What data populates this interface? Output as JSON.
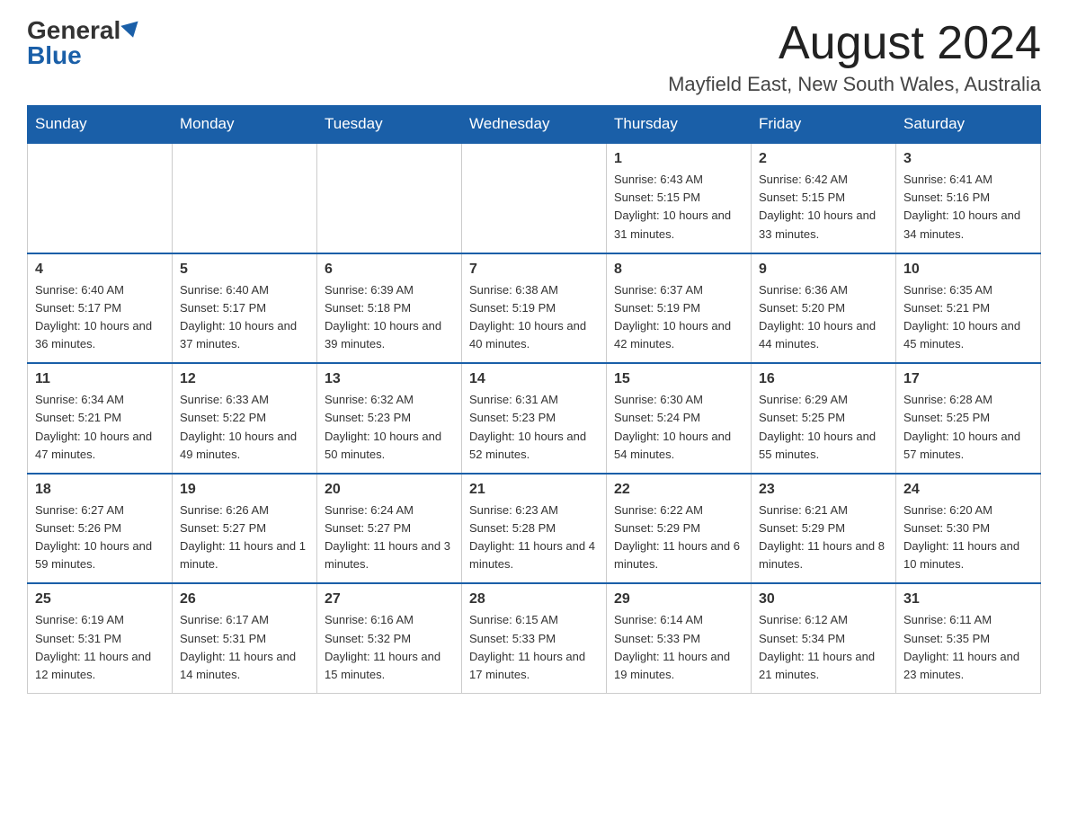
{
  "logo": {
    "general": "General",
    "blue": "Blue"
  },
  "title": {
    "month_year": "August 2024",
    "location": "Mayfield East, New South Wales, Australia"
  },
  "days_of_week": [
    "Sunday",
    "Monday",
    "Tuesday",
    "Wednesday",
    "Thursday",
    "Friday",
    "Saturday"
  ],
  "weeks": [
    [
      {
        "day": "",
        "info": ""
      },
      {
        "day": "",
        "info": ""
      },
      {
        "day": "",
        "info": ""
      },
      {
        "day": "",
        "info": ""
      },
      {
        "day": "1",
        "info": "Sunrise: 6:43 AM\nSunset: 5:15 PM\nDaylight: 10 hours and 31 minutes."
      },
      {
        "day": "2",
        "info": "Sunrise: 6:42 AM\nSunset: 5:15 PM\nDaylight: 10 hours and 33 minutes."
      },
      {
        "day": "3",
        "info": "Sunrise: 6:41 AM\nSunset: 5:16 PM\nDaylight: 10 hours and 34 minutes."
      }
    ],
    [
      {
        "day": "4",
        "info": "Sunrise: 6:40 AM\nSunset: 5:17 PM\nDaylight: 10 hours and 36 minutes."
      },
      {
        "day": "5",
        "info": "Sunrise: 6:40 AM\nSunset: 5:17 PM\nDaylight: 10 hours and 37 minutes."
      },
      {
        "day": "6",
        "info": "Sunrise: 6:39 AM\nSunset: 5:18 PM\nDaylight: 10 hours and 39 minutes."
      },
      {
        "day": "7",
        "info": "Sunrise: 6:38 AM\nSunset: 5:19 PM\nDaylight: 10 hours and 40 minutes."
      },
      {
        "day": "8",
        "info": "Sunrise: 6:37 AM\nSunset: 5:19 PM\nDaylight: 10 hours and 42 minutes."
      },
      {
        "day": "9",
        "info": "Sunrise: 6:36 AM\nSunset: 5:20 PM\nDaylight: 10 hours and 44 minutes."
      },
      {
        "day": "10",
        "info": "Sunrise: 6:35 AM\nSunset: 5:21 PM\nDaylight: 10 hours and 45 minutes."
      }
    ],
    [
      {
        "day": "11",
        "info": "Sunrise: 6:34 AM\nSunset: 5:21 PM\nDaylight: 10 hours and 47 minutes."
      },
      {
        "day": "12",
        "info": "Sunrise: 6:33 AM\nSunset: 5:22 PM\nDaylight: 10 hours and 49 minutes."
      },
      {
        "day": "13",
        "info": "Sunrise: 6:32 AM\nSunset: 5:23 PM\nDaylight: 10 hours and 50 minutes."
      },
      {
        "day": "14",
        "info": "Sunrise: 6:31 AM\nSunset: 5:23 PM\nDaylight: 10 hours and 52 minutes."
      },
      {
        "day": "15",
        "info": "Sunrise: 6:30 AM\nSunset: 5:24 PM\nDaylight: 10 hours and 54 minutes."
      },
      {
        "day": "16",
        "info": "Sunrise: 6:29 AM\nSunset: 5:25 PM\nDaylight: 10 hours and 55 minutes."
      },
      {
        "day": "17",
        "info": "Sunrise: 6:28 AM\nSunset: 5:25 PM\nDaylight: 10 hours and 57 minutes."
      }
    ],
    [
      {
        "day": "18",
        "info": "Sunrise: 6:27 AM\nSunset: 5:26 PM\nDaylight: 10 hours and 59 minutes."
      },
      {
        "day": "19",
        "info": "Sunrise: 6:26 AM\nSunset: 5:27 PM\nDaylight: 11 hours and 1 minute."
      },
      {
        "day": "20",
        "info": "Sunrise: 6:24 AM\nSunset: 5:27 PM\nDaylight: 11 hours and 3 minutes."
      },
      {
        "day": "21",
        "info": "Sunrise: 6:23 AM\nSunset: 5:28 PM\nDaylight: 11 hours and 4 minutes."
      },
      {
        "day": "22",
        "info": "Sunrise: 6:22 AM\nSunset: 5:29 PM\nDaylight: 11 hours and 6 minutes."
      },
      {
        "day": "23",
        "info": "Sunrise: 6:21 AM\nSunset: 5:29 PM\nDaylight: 11 hours and 8 minutes."
      },
      {
        "day": "24",
        "info": "Sunrise: 6:20 AM\nSunset: 5:30 PM\nDaylight: 11 hours and 10 minutes."
      }
    ],
    [
      {
        "day": "25",
        "info": "Sunrise: 6:19 AM\nSunset: 5:31 PM\nDaylight: 11 hours and 12 minutes."
      },
      {
        "day": "26",
        "info": "Sunrise: 6:17 AM\nSunset: 5:31 PM\nDaylight: 11 hours and 14 minutes."
      },
      {
        "day": "27",
        "info": "Sunrise: 6:16 AM\nSunset: 5:32 PM\nDaylight: 11 hours and 15 minutes."
      },
      {
        "day": "28",
        "info": "Sunrise: 6:15 AM\nSunset: 5:33 PM\nDaylight: 11 hours and 17 minutes."
      },
      {
        "day": "29",
        "info": "Sunrise: 6:14 AM\nSunset: 5:33 PM\nDaylight: 11 hours and 19 minutes."
      },
      {
        "day": "30",
        "info": "Sunrise: 6:12 AM\nSunset: 5:34 PM\nDaylight: 11 hours and 21 minutes."
      },
      {
        "day": "31",
        "info": "Sunrise: 6:11 AM\nSunset: 5:35 PM\nDaylight: 11 hours and 23 minutes."
      }
    ]
  ]
}
